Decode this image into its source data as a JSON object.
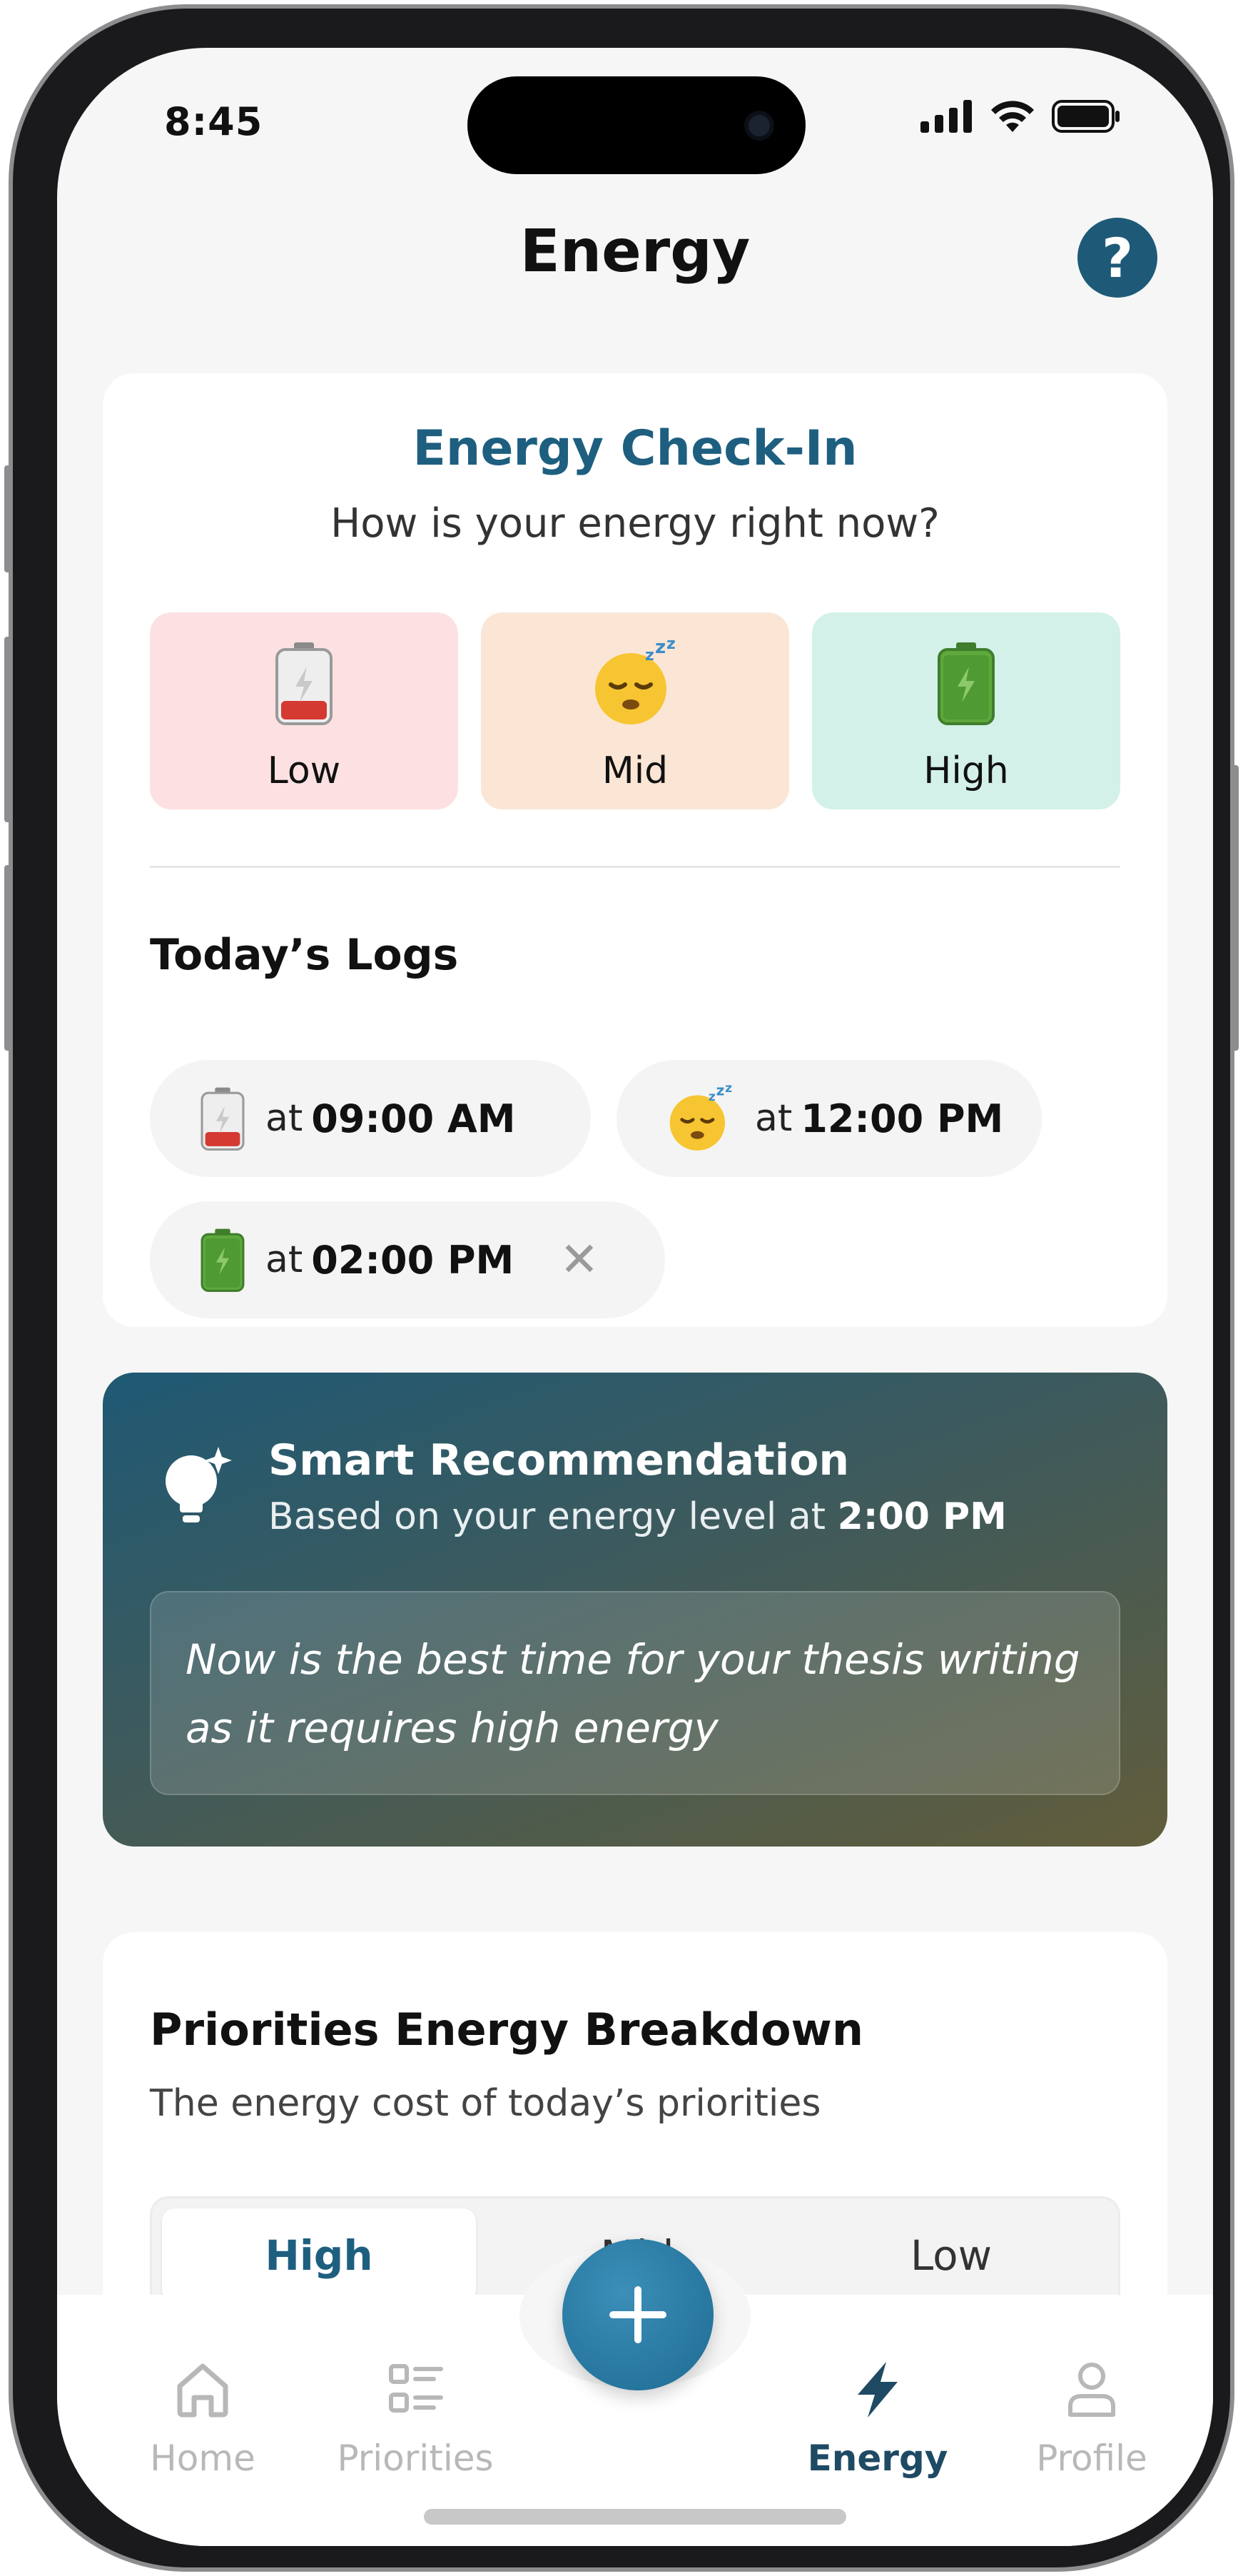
{
  "status_bar": {
    "time": "8:45"
  },
  "header": {
    "title": "Energy",
    "help_label": "?"
  },
  "checkin": {
    "title": "Energy Check-In",
    "subtitle": "How is your energy right now?",
    "levels": [
      {
        "label": "Low",
        "icon": "battery-low-icon"
      },
      {
        "label": "Mid",
        "icon": "sleepy-face-icon"
      },
      {
        "label": "High",
        "icon": "battery-full-icon"
      }
    ],
    "logs_title": "Today’s Logs",
    "logs": [
      {
        "at": "at",
        "time": "09:00 AM",
        "icon": "battery-low-icon"
      },
      {
        "at": "at",
        "time": "12:00 PM",
        "icon": "sleepy-face-icon"
      },
      {
        "at": "at",
        "time": "02:00 PM",
        "icon": "battery-full-icon",
        "close": "✕"
      }
    ]
  },
  "recommendation": {
    "title": "Smart Recommendation",
    "subtitle_prefix": "Based on your energy level at",
    "subtitle_time": "2:00 PM",
    "message": "Now is the best time for your thesis writing as it requires high energy",
    "icon": "lightbulb-sparkle-icon"
  },
  "breakdown": {
    "title": "Priorities Energy Breakdown",
    "subtitle": "The energy cost of today’s priorities",
    "segments": [
      "High",
      "Mid",
      "Low"
    ],
    "active_segment": "High"
  },
  "tabbar": {
    "items": [
      {
        "label": "Home",
        "icon": "home-icon"
      },
      {
        "label": "Priorities",
        "icon": "list-icon"
      },
      {
        "label": "Energy",
        "icon": "lightning-icon"
      },
      {
        "label": "Profile",
        "icon": "person-icon"
      }
    ],
    "active": "Energy",
    "fab_icon": "plus-icon"
  },
  "colors": {
    "accent": "#1e5f80",
    "low_bg": "#fde1e2",
    "mid_bg": "#fbe6d6",
    "high_bg": "#d3f1e9"
  }
}
